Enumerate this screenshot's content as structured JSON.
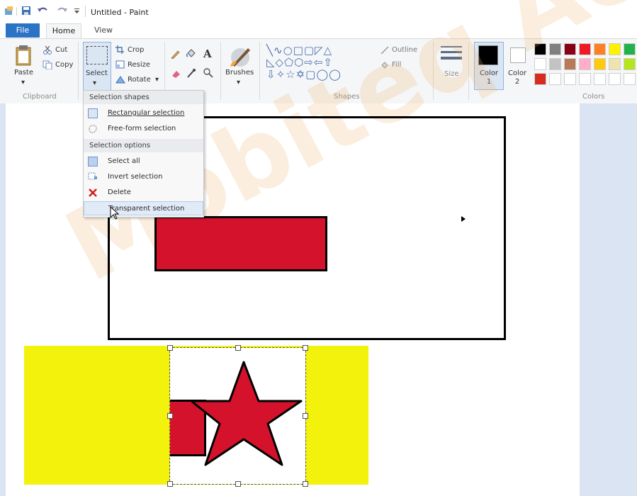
{
  "window": {
    "title": "Untitled - Paint"
  },
  "tabs": {
    "file": "File",
    "home": "Home",
    "view": "View"
  },
  "clipboard": {
    "paste": "Paste",
    "cut": "Cut",
    "copy": "Copy",
    "group_label": "Clipboard"
  },
  "image": {
    "select": "Select",
    "crop": "Crop",
    "resize": "Resize",
    "rotate": "Rotate"
  },
  "tools": {
    "brushes": "Brushes"
  },
  "shapes": {
    "outline": "Outline",
    "fill": "Fill",
    "group_label": "Shapes",
    "glyphs": "╲∿○□▢◸△ ◺◇⬠⬡⇨⇦⇧ ⇩✧☆✡▢◯◯"
  },
  "size": {
    "label": "Size"
  },
  "colors": {
    "color1": "Color 1",
    "color2": "Color 2",
    "group_label": "Colors",
    "color1_value": "#000000",
    "color2_value": "#ffffff",
    "palette": [
      "#000000",
      "#7f7f7f",
      "#880015",
      "#ed1c24",
      "#ff7f27",
      "#fff200",
      "#22b14c",
      "#ffffff",
      "#c3c3c3",
      "#b97a57",
      "#ffaec9",
      "#ffc90e",
      "#efe4b0",
      "#b5e61d",
      "#d62b1f",
      "#ffffff",
      "#ffffff",
      "#ffffff",
      "#ffffff",
      "#ffffff",
      "#ffffff"
    ]
  },
  "select_menu": {
    "header_shapes": "Selection shapes",
    "rectangular": "Rectangular selection",
    "freeform": "Free-form selection",
    "header_options": "Selection options",
    "select_all": "Select all",
    "invert": "Invert selection",
    "delete": "Delete",
    "transparent": "Transparent selection"
  },
  "watermark": {
    "text": "Mobiteq Ac"
  }
}
